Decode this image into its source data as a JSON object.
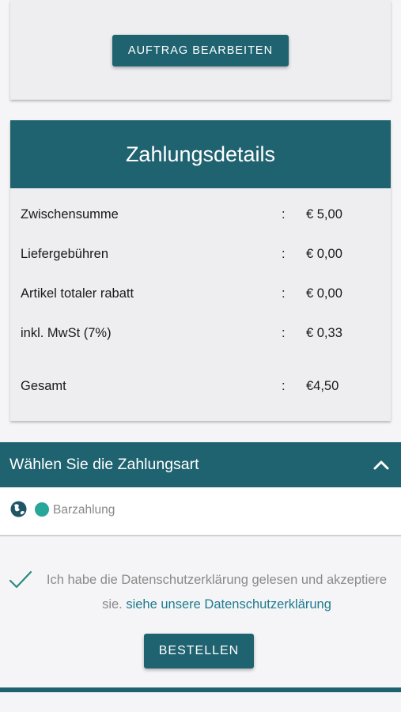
{
  "order": {
    "edit_button_label": "AUFTRAG BEARBEITEN"
  },
  "payment_details": {
    "title": "Zahlungsdetails",
    "rows": [
      {
        "label": "Zwischensumme",
        "separator": ":",
        "value": "€ 5,00"
      },
      {
        "label": "Liefergebühren",
        "separator": ":",
        "value": "€ 0,00"
      },
      {
        "label": "Artikel totaler rabatt",
        "separator": ":",
        "value": "€ 0,00"
      },
      {
        "label": "inkl. MwSt (7%)",
        "separator": ":",
        "value": "€ 0,33"
      },
      {
        "label": "Gesamt",
        "separator": ":",
        "value": "€4,50"
      }
    ]
  },
  "payment_method": {
    "title": "Wählen Sie die Zahlungsart",
    "toggle_icon": "chevron-up-icon",
    "option_icon": "globe-icon",
    "selected_option": "Barzahlung"
  },
  "consent": {
    "check_icon": "checkmark-icon",
    "text": "Ich habe die Datenschutzerklärung gelesen und akzeptiere sie.",
    "link_text": "siehe unsere Datenschutzerklärung"
  },
  "actions": {
    "order_button_label": "BESTELLEN"
  },
  "colors": {
    "primary": "#1f6270",
    "radio_selected": "#28a69a",
    "link": "#1f7a8e"
  }
}
